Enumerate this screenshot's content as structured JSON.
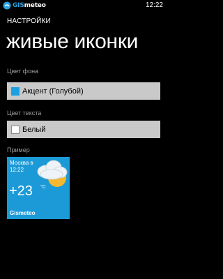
{
  "status_bar": {
    "logo_prefix": "GIS",
    "logo_suffix": "meteo",
    "time": "12:22"
  },
  "header": {
    "app_title": "НАСТРОЙКИ",
    "page_title": "живые иконки"
  },
  "background_color": {
    "label": "Цвет фона",
    "value": "Акцент (Голубой)",
    "swatch_color": "#1ba1e2"
  },
  "text_color": {
    "label": "Цвет текста",
    "value": "Белый",
    "swatch_color": "#ffffff"
  },
  "preview": {
    "label": "Пример",
    "tile": {
      "city": "Москва в",
      "time": "12:22",
      "temperature": "+23",
      "unit": "°C",
      "brand": "Gismeteo",
      "background": "#1c9ad7",
      "icon": "partly-cloudy-icon"
    }
  },
  "colors": {
    "accent": "#1ba1e2",
    "picker_bg": "#c9c9c9",
    "label_gray": "#9a9a9a"
  }
}
